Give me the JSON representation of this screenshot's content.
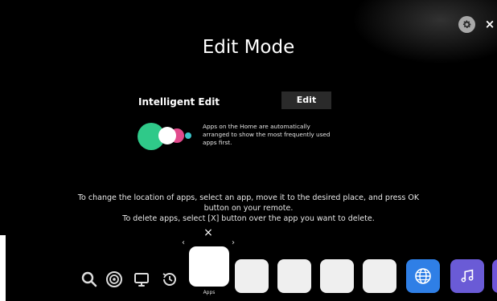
{
  "title": "Edit Mode",
  "intelligent_edit": {
    "label": "Intelligent Edit",
    "button_label": "Edit",
    "description": "Apps on the Home are automatically arranged to show the most frequently used apps first."
  },
  "instructions": {
    "line1": "To change the location of apps, select an app, move it to the desired place, and press OK",
    "line2": "button on your remote.",
    "line3": "To delete apps, select [X] button over the app you want to delete."
  },
  "top_controls": {
    "settings_icon": "gear-icon",
    "close_label": "×"
  },
  "selected_app": {
    "delete_mark": "×",
    "label": "Apps",
    "left_arrow": "‹",
    "right_arrow": "›"
  },
  "bottom_bar_icons": [
    "search-icon",
    "sports-icon",
    "tv-icon",
    "history-icon"
  ],
  "app_tiles": [
    "blank",
    "blank",
    "blank",
    "blank",
    "web-browser",
    "music"
  ],
  "colors": {
    "background": "#000000",
    "edit_button_bg": "#2a2a2a",
    "ie_green": "#2fc989",
    "ie_pink": "#e24a8c",
    "ie_teal": "#3cc3c8",
    "web_tile": "#2f7fe6",
    "music_tile": "#6a5bd6"
  }
}
